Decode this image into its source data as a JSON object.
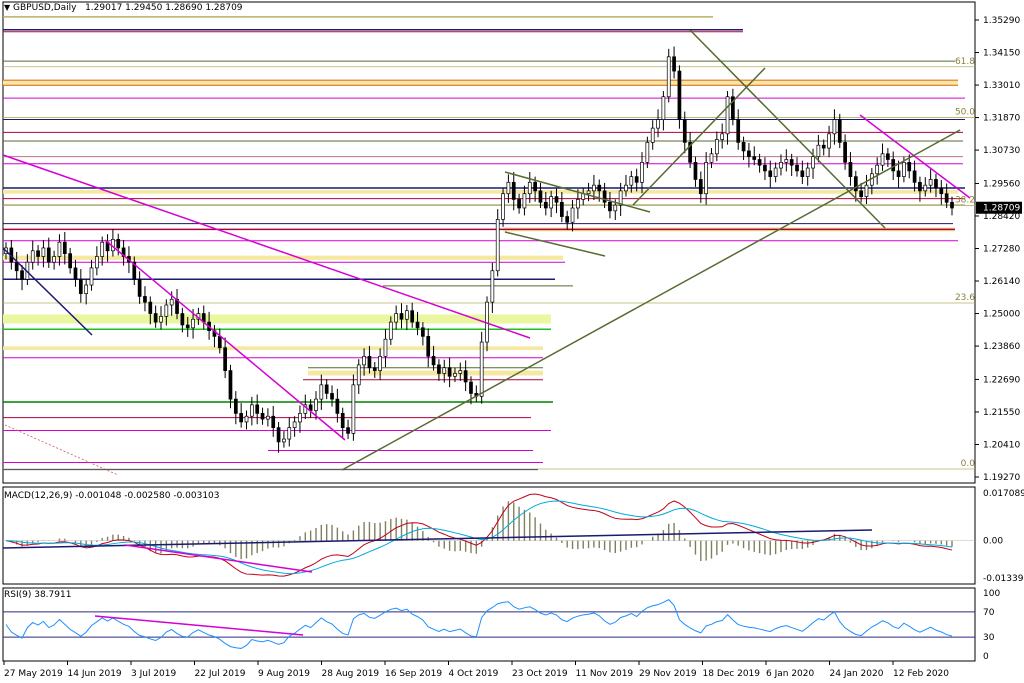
{
  "header": {
    "symbol_label": "GBPUSD,Daily",
    "ohlc": "1.29017 1.29450 1.28690 1.28709",
    "dropdown_icon": "triangle-down-icon"
  },
  "chart_data": [
    {
      "type": "candlestick",
      "title": "GBPUSD,Daily",
      "open": 1.29017,
      "high": 1.2945,
      "low": 1.2869,
      "close": 1.28709,
      "current_price_label": "1.28709",
      "ylim": [
        1.1927,
        1.3529
      ],
      "y_tick_labels": [
        "1.35290",
        "1.34150",
        "1.33010",
        "1.31870",
        "1.30730",
        "1.29560",
        "1.28420",
        "1.27280",
        "1.26140",
        "1.25000",
        "1.23860",
        "1.22690",
        "1.21550",
        "1.20410",
        "1.19270"
      ],
      "x_tick_labels": [
        "27 May 2019",
        "14 Jun 2019",
        "3 Jul 2019",
        "22 Jul 2019",
        "9 Aug 2019",
        "28 Aug 2019",
        "16 Sep 2019",
        "4 Oct 2019",
        "23 Oct 2019",
        "11 Nov 2019",
        "29 Nov 2019",
        "18 Dec 2019",
        "6 Jan 2020",
        "24 Jan 2020",
        "12 Feb 2020"
      ],
      "fibonacci_labels": [
        "61.8",
        "50.0",
        "38.2",
        "23.6",
        "0.0"
      ],
      "fibonacci_levels": [
        1.3365,
        1.3187,
        1.2879,
        1.2537,
        1.1955
      ],
      "fibonacci_color": "#b8b060",
      "approx_closes": [
        1.273,
        1.268,
        1.265,
        1.262,
        1.268,
        1.272,
        1.27,
        1.273,
        1.268,
        1.27,
        1.275,
        1.271,
        1.266,
        1.262,
        1.257,
        1.26,
        1.266,
        1.27,
        1.275,
        1.272,
        1.276,
        1.273,
        1.27,
        1.268,
        1.262,
        1.256,
        1.254,
        1.25,
        1.247,
        1.249,
        1.253,
        1.255,
        1.25,
        1.246,
        1.245,
        1.248,
        1.25,
        1.247,
        1.244,
        1.242,
        1.238,
        1.23,
        1.22,
        1.215,
        1.212,
        1.214,
        1.218,
        1.215,
        1.213,
        1.214,
        1.21,
        1.205,
        1.206,
        1.21,
        1.212,
        1.215,
        1.218,
        1.216,
        1.22,
        1.225,
        1.222,
        1.22,
        1.215,
        1.21,
        1.208,
        1.225,
        1.232,
        1.235,
        1.231,
        1.23,
        1.235,
        1.241,
        1.247,
        1.25,
        1.248,
        1.251,
        1.247,
        1.245,
        1.242,
        1.235,
        1.232,
        1.229,
        1.231,
        1.228,
        1.229,
        1.23,
        1.226,
        1.222,
        1.221,
        1.24,
        1.254,
        1.265,
        1.283,
        1.292,
        1.296,
        1.29,
        1.287,
        1.292,
        1.296,
        1.293,
        1.289,
        1.287,
        1.291,
        1.289,
        1.284,
        1.282,
        1.287,
        1.29,
        1.292,
        1.293,
        1.295,
        1.293,
        1.289,
        1.286,
        1.288,
        1.293,
        1.295,
        1.298,
        1.296,
        1.303,
        1.31,
        1.315,
        1.318,
        1.326,
        1.34,
        1.335,
        1.318,
        1.31,
        1.303,
        1.297,
        1.292,
        1.303,
        1.306,
        1.311,
        1.313,
        1.326,
        1.318,
        1.31,
        1.307,
        1.305,
        1.304,
        1.302,
        1.3,
        1.298,
        1.301,
        1.303,
        1.304,
        1.302,
        1.3,
        1.298,
        1.301,
        1.305,
        1.309,
        1.308,
        1.313,
        1.318,
        1.31,
        1.303,
        1.298,
        1.293,
        1.291,
        1.295,
        1.299,
        1.302,
        1.306,
        1.304,
        1.3,
        1.298,
        1.303,
        1.3,
        1.296,
        1.293,
        1.295,
        1.297,
        1.294,
        1.292,
        1.289,
        1.287
      ]
    },
    {
      "type": "macd",
      "label": "MACD(12,26,9) -0.001048 -0.002580 -0.003103",
      "y_tick_labels": [
        "0.017089",
        "0.00",
        "-0.013398"
      ],
      "ylim": [
        -0.0134,
        0.0171
      ]
    },
    {
      "type": "rsi",
      "label": "RSI(9) 38.7911",
      "y_tick_labels": [
        "100",
        "70",
        "30",
        "0"
      ],
      "ylim": [
        0,
        100
      ],
      "levels": [
        70,
        30
      ]
    }
  ],
  "colors": {
    "bull_candle": "#ffffff",
    "bear_candle": "#000000",
    "magenta_lines": "#d400d4",
    "olive_lines": "#556b2f",
    "navy_lines": "#1a1a6e",
    "crimson_lines": "#b0003a",
    "yellow_zone": "#f5e8a0",
    "lime_zone": "#eaf7a0",
    "macd_line": "#c0001a",
    "signal_line": "#00aadd",
    "rsi_line": "#1e90ff"
  }
}
